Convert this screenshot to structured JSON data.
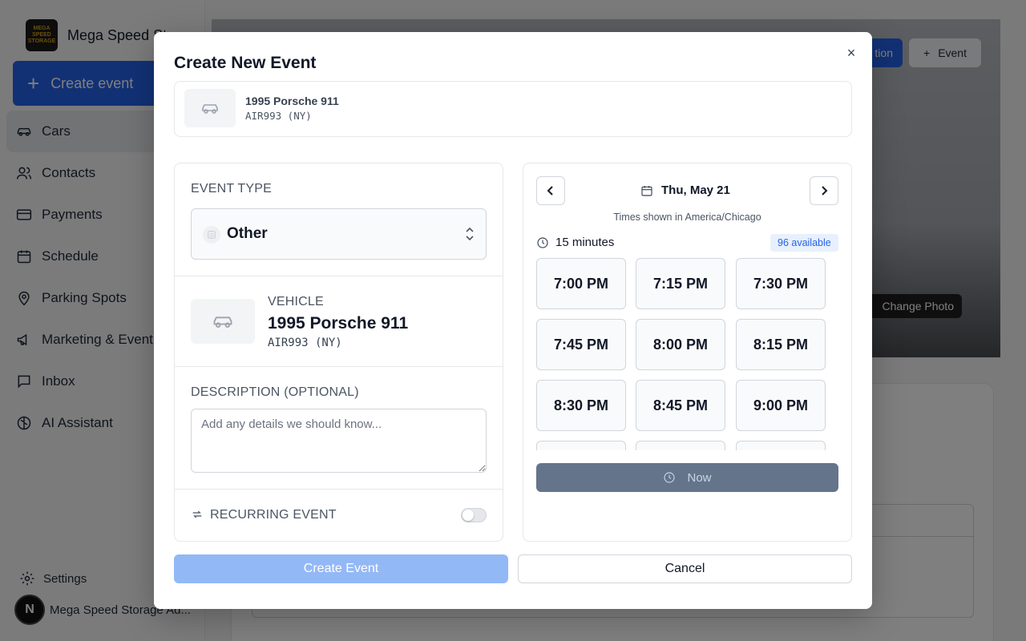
{
  "app": {
    "brand_name": "Mega Speed St",
    "logo_text_1": "MEGA SPEED",
    "logo_text_2": "STORAGE",
    "create_event_label": "Create event",
    "nav": [
      {
        "label": "Cars",
        "icon": "car-icon",
        "active": true
      },
      {
        "label": "Contacts",
        "icon": "users-icon"
      },
      {
        "label": "Payments",
        "icon": "credit-card-icon"
      },
      {
        "label": "Schedule",
        "icon": "calendar-icon"
      },
      {
        "label": "Parking Spots",
        "icon": "map-pin-icon"
      },
      {
        "label": "Marketing & Event",
        "icon": "megaphone-icon"
      },
      {
        "label": "Inbox",
        "icon": "message-square-icon"
      },
      {
        "label": "AI Assistant",
        "icon": "brain-icon"
      }
    ],
    "settings_label": "Settings",
    "user_initial": "N",
    "user_name": "Mega Speed Storage Ad...",
    "header_button_blue": "tion",
    "header_button_event": "Event",
    "change_photo_label": "Change Photo"
  },
  "modal": {
    "title": "Create New Event",
    "close_icon": "×",
    "vehicle": {
      "name": "1995 Porsche 911",
      "plate": "AIR993 (NY)"
    },
    "event_type": {
      "label": "EVENT TYPE",
      "value": "Other"
    },
    "vehicle_section": {
      "label": "VEHICLE",
      "name": "1995 Porsche 911",
      "plate": "AIR993 (NY)"
    },
    "description": {
      "label": "DESCRIPTION (OPTIONAL)",
      "value": "",
      "placeholder": "Add any details we should know..."
    },
    "recurring": {
      "label": "RECURRING EVENT",
      "enabled": false
    },
    "schedule": {
      "date": "Thu, May 21",
      "timezone_note": "Times shown in America/Chicago",
      "duration": "15 minutes",
      "available": "96 available",
      "slots": [
        "7:00 PM",
        "7:15 PM",
        "7:30 PM",
        "7:45 PM",
        "8:00 PM",
        "8:15 PM",
        "8:30 PM",
        "8:45 PM",
        "9:00 PM",
        "",
        "",
        ""
      ],
      "now_label": "Now"
    },
    "submit_label": "Create Event",
    "cancel_label": "Cancel"
  },
  "colors": {
    "accent": "#2563eb",
    "submit_disabled": "#93b8f6",
    "now_button": "#64748b",
    "badge_bg": "#e8f0fd"
  }
}
